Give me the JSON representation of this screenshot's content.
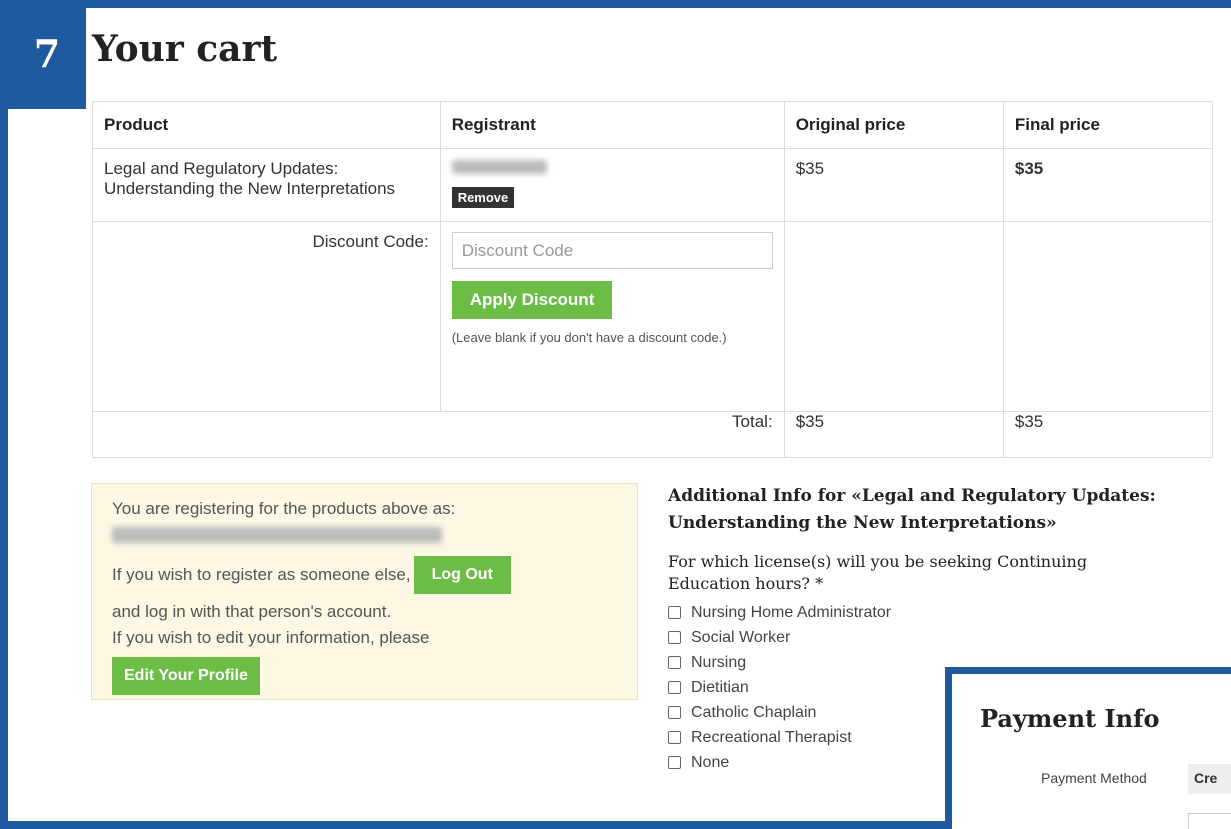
{
  "step": {
    "number": "7"
  },
  "cart": {
    "title": "Your cart",
    "headers": {
      "product": "Product",
      "registrant": "Registrant",
      "original_price": "Original price",
      "final_price": "Final price"
    },
    "item": {
      "product": "Legal and Regulatory Updates: Understanding the New Interpretations",
      "remove_label": "Remove",
      "original_price": "$35",
      "final_price": "$35"
    },
    "discount": {
      "label": "Discount Code:",
      "placeholder": "Discount Code",
      "apply_label": "Apply Discount",
      "hint": "(Leave blank if you don't have a discount code.)"
    },
    "total": {
      "label": "Total:",
      "original": "$35",
      "final": "$35"
    }
  },
  "registration": {
    "line1": "You are registering for the products above as:",
    "line2": "If you wish to register as someone else,",
    "logout_label": "Log Out",
    "line3": "and log in with that person's account.",
    "line4": "If you wish to edit your information, please",
    "edit_label": "Edit Your Profile"
  },
  "additional_info": {
    "title": "Additional Info for «Legal and Regulatory Updates: Understanding the New Interpretations»",
    "question": "For which license(s) will you be seeking Continuing Education hours? *",
    "options": [
      "Nursing Home Administrator",
      "Social Worker",
      "Nursing",
      "Dietitian",
      "Catholic Chaplain",
      "Recreational Therapist",
      "None"
    ]
  },
  "payment": {
    "title": "Payment Info",
    "method_label": "Payment Method",
    "method_value": "Cre"
  },
  "colors": {
    "frame_blue": "#1f5aa0",
    "button_green": "#6cbd45",
    "notice_bg": "#fcf8e3"
  }
}
